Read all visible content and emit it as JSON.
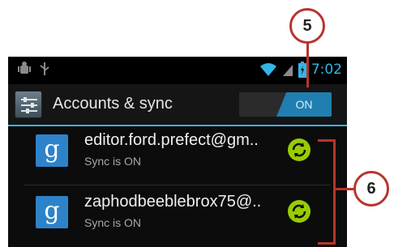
{
  "status_bar": {
    "time": "7:02",
    "icons": [
      "android-debug-icon",
      "usb-icon",
      "wifi-icon",
      "signal-icon",
      "battery-charging-icon"
    ]
  },
  "action_bar": {
    "title": "Accounts & sync",
    "icon": "settings-sliders-icon",
    "toggle_label": "ON"
  },
  "accounts": [
    {
      "name": "editor.ford.prefect@gm..",
      "status": "Sync is ON",
      "icon_letter": "g"
    },
    {
      "name": "zaphodbeeblebrox75@..",
      "status": "Sync is ON",
      "icon_letter": "g"
    }
  ],
  "callouts": {
    "top": "5",
    "side": "6"
  },
  "colors": {
    "accent": "#33b5e5",
    "toggle_on": "#1f7fb0",
    "sync_green": "#99cc00",
    "callout_red": "#b8342c",
    "google_blue": "#2d83c9"
  }
}
